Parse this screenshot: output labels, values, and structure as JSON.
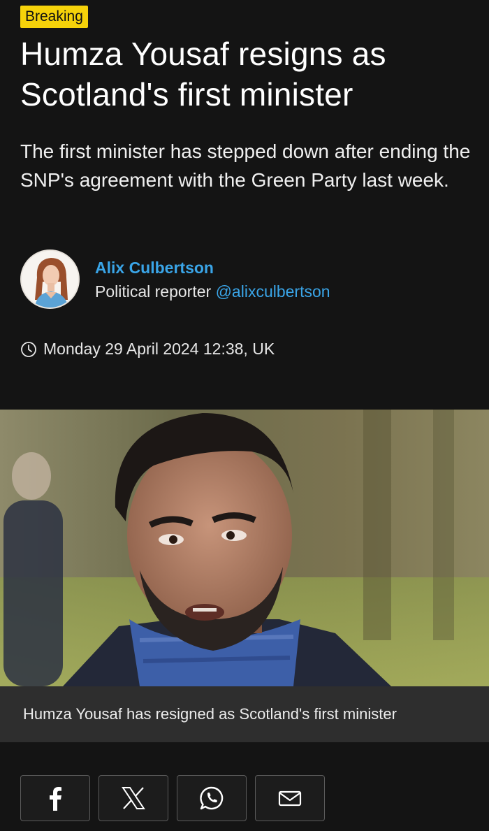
{
  "article": {
    "badge": "Breaking",
    "headline": "Humza Yousaf resigns as Scotland's first minister",
    "standfirst": "The first minister has stepped down after ending the SNP's agreement with the Green Party last week.",
    "author": {
      "name": "Alix Culbertson",
      "role": "Political reporter",
      "handle": "@alixculbertson"
    },
    "timestamp": "Monday 29 April 2024 12:38, UK",
    "image_caption": "Humza Yousaf has resigned as Scotland's first minister"
  },
  "share": {
    "buttons": [
      {
        "icon": "facebook-icon"
      },
      {
        "icon": "x-icon"
      },
      {
        "icon": "whatsapp-icon"
      },
      {
        "icon": "email-icon"
      }
    ]
  },
  "colors": {
    "background": "#141414",
    "badge": "#f5d20a",
    "accent_link": "#3aa5e8",
    "caption_bg": "#2e2e2e"
  }
}
